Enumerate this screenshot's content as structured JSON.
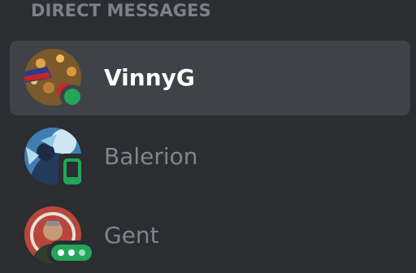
{
  "section": {
    "title": "DIRECT MESSAGES"
  },
  "dms": [
    {
      "name": "VinnyG",
      "status": "online",
      "selected": true
    },
    {
      "name": "Balerion",
      "status": "mobile",
      "selected": false
    },
    {
      "name": "Gent",
      "status": "typing",
      "selected": false
    }
  ],
  "colors": {
    "sidebar_bg": "#2b2d31",
    "selected_bg": "#404249",
    "online_green": "#23a55a",
    "muted_text": "#80848e",
    "header_text": "#7c8088"
  }
}
